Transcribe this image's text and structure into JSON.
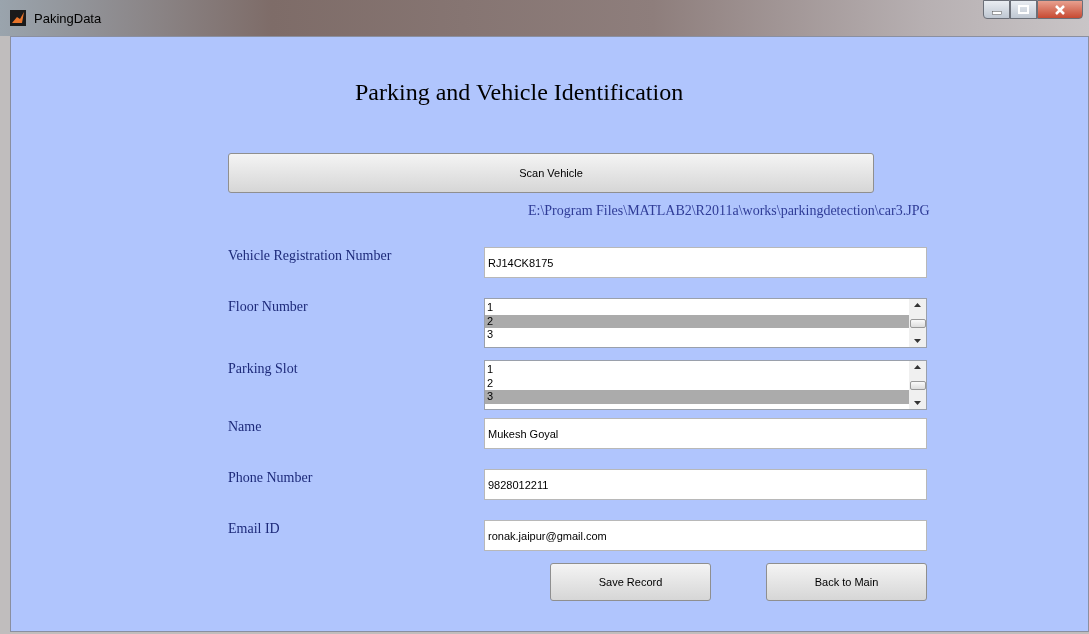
{
  "window": {
    "title": "PakingData"
  },
  "heading": "Parking and Vehicle Identification",
  "scan_button": "Scan Vehicle",
  "file_path": "E:\\Program Files\\MATLAB2\\R2011a\\works\\parkingdetection\\car3.JPG",
  "fields": [
    {
      "kind": "text",
      "label": "Vehicle Registration Number",
      "value": "RJ14CK8175"
    },
    {
      "kind": "list",
      "label": "Floor Number",
      "items": [
        {
          "label": "1",
          "selected": false
        },
        {
          "label": "2",
          "selected": true
        },
        {
          "label": "3",
          "selected": false
        }
      ]
    },
    {
      "kind": "list",
      "label": "Parking Slot",
      "items": [
        {
          "label": "1",
          "selected": false
        },
        {
          "label": "2",
          "selected": false
        },
        {
          "label": "3",
          "selected": true
        }
      ]
    },
    {
      "kind": "text",
      "label": "Name",
      "value": "Mukesh Goyal"
    },
    {
      "kind": "text",
      "label": "Phone Number",
      "value": "9828012211"
    },
    {
      "kind": "text",
      "label": "Email ID",
      "value": "ronak.jaipur@gmail.com"
    }
  ],
  "buttons": [
    "Save Record",
    "Back to Main"
  ]
}
